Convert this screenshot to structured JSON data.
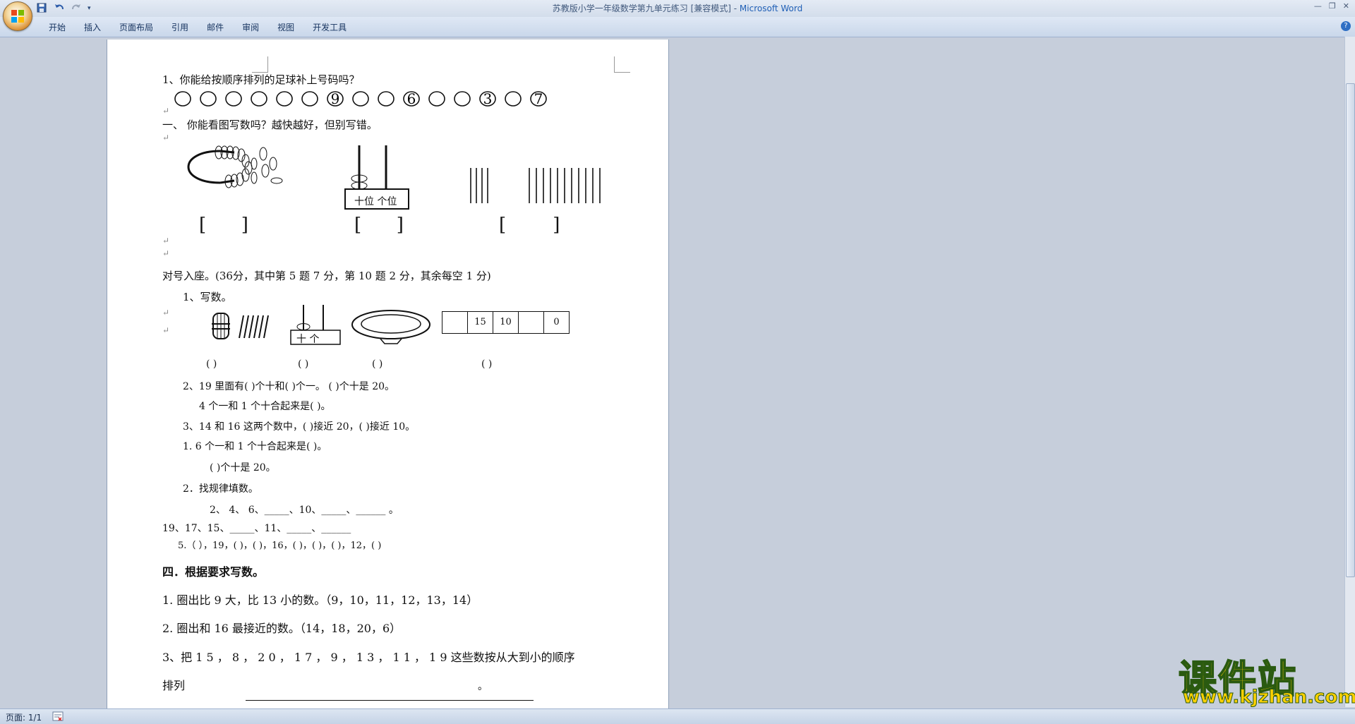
{
  "window": {
    "title_doc": "苏教版小学一年级数学第九单元练习 [兼容模式] - ",
    "title_app": "Microsoft Word"
  },
  "ribbon": {
    "tabs": [
      "开始",
      "插入",
      "页面布局",
      "引用",
      "邮件",
      "审阅",
      "视图",
      "开发工具"
    ]
  },
  "document": {
    "q1_title": "1、你能给按顺序排列的足球补上号码吗？",
    "balls": [
      "",
      "",
      "",
      "",
      "",
      "",
      "9",
      "",
      "",
      "6",
      "",
      "",
      "3",
      "",
      "7"
    ],
    "sec1_title": "一、     你能看图写数吗？越快越好，但别写错。",
    "abacus_label": "十位   个位",
    "sec_duihao": "对号入座。(36分，其中第 5 题 7 分，第 10 题 2 分，其余每空 1 分)",
    "q_xieshu": "1、写数。",
    "abacus2_label": "十   个",
    "box_cells": [
      "",
      "15",
      "10",
      "",
      "0"
    ],
    "blanks_row": [
      "(     )",
      "(     )",
      "(     )",
      "(     )"
    ],
    "q2": "2、19 里面有(     )个十和(     )个一。     (     )个十是 20。",
    "q2b": "4 个一和 1 个十合起来是(     )。",
    "q3": "3、14 和 16 这两个数中，(     )接近 20，(     )接近 10。",
    "q4": "1.    6 个一和 1 个十合起来是(     )。",
    "q4b": "(     )个十是 20。",
    "q5": "2．找规律填数。",
    "q5a": "2、  4、  6、_____、10、_____、______ 。",
    "q5b": "19、17、15、_____、11、_____、______",
    "q5c": "5.（  ），19，(  )，(  )，16，(  )，(  )，(  )，12，(  )",
    "sec4_title": "四．根据要求写数。",
    "s4_1": "1.      圈出比 9 大，比 13 小的数。（9，10，11，12，13，14）",
    "s4_2": "2.      圈出和 16 最接近的数。（14，18，20，6）",
    "s4_3": "3、把 1 5 ， 8 ， 2 0 ， 1 7 ， 9 ， 1 3 ， 1 1 ， 1 9 这些数按从大到小的顺序",
    "s4_4": "排列",
    "s4_4_end": "。"
  },
  "status": {
    "page": "页面: 1/1"
  },
  "watermark": {
    "cn": "课件站",
    "url": "www.kjzhan.com"
  },
  "colors": {
    "ribbon_bg": "#c9d7ea",
    "canvas_bg": "#c6cedb",
    "watermark_fill": "#ffd100",
    "title_app": "#1f5fb6"
  }
}
